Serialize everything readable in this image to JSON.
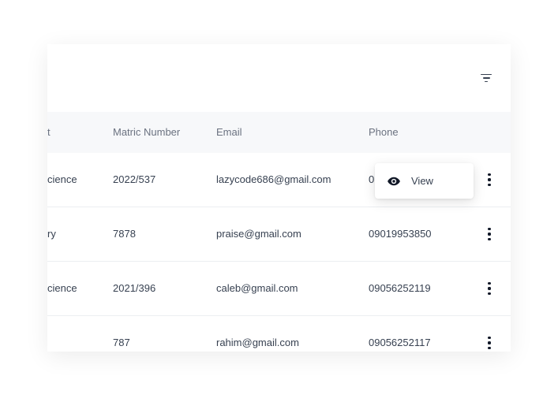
{
  "table": {
    "headers": {
      "department": "t",
      "matric_number": "Matric Number",
      "email": "Email",
      "phone": "Phone"
    },
    "rows": [
      {
        "department": "cience",
        "matric_number": "2022/537",
        "email": "lazycode686@gmail.com",
        "phone": "0"
      },
      {
        "department": "ry",
        "matric_number": "7878",
        "email": "praise@gmail.com",
        "phone": "09019953850"
      },
      {
        "department": "cience",
        "matric_number": "2021/396",
        "email": "caleb@gmail.com",
        "phone": "09056252119"
      },
      {
        "department": "",
        "matric_number": "787",
        "email": "rahim@gmail.com",
        "phone": "09056252117"
      }
    ]
  },
  "row_menu": {
    "view_label": "View",
    "icon": "eye-icon"
  },
  "toolbar": {
    "filter_icon": "filter-icon"
  },
  "colors": {
    "header_bg": "#f7f8fa",
    "text": "#374151",
    "muted": "#6b7280"
  }
}
